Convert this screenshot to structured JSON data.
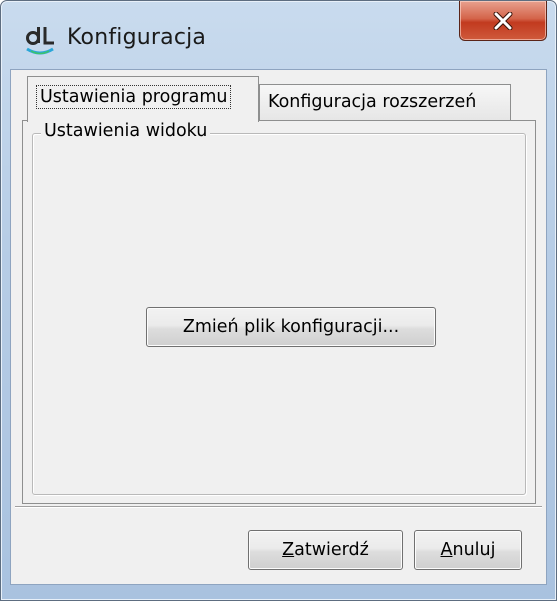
{
  "window": {
    "title": "Konfiguracja",
    "app_icon": "dl-logo-icon",
    "close_icon": "close-x-icon"
  },
  "tabs": [
    {
      "label": "Ustawienia programu",
      "active": true
    },
    {
      "label": "Konfiguracja rozszerzeń",
      "active": false
    }
  ],
  "groupbox": {
    "legend": "Ustawienia widoku",
    "change_config_button": "Zmień plik konfiguracji..."
  },
  "footer": {
    "confirm_button": {
      "mnemonic": "Z",
      "rest": "atwierdź"
    },
    "cancel_button": {
      "mnemonic": "A",
      "rest": "nuluj"
    }
  },
  "colors": {
    "titlebar": "#b7cde6",
    "close_button": "#c23a1f",
    "client_background": "#f0f0f0"
  }
}
